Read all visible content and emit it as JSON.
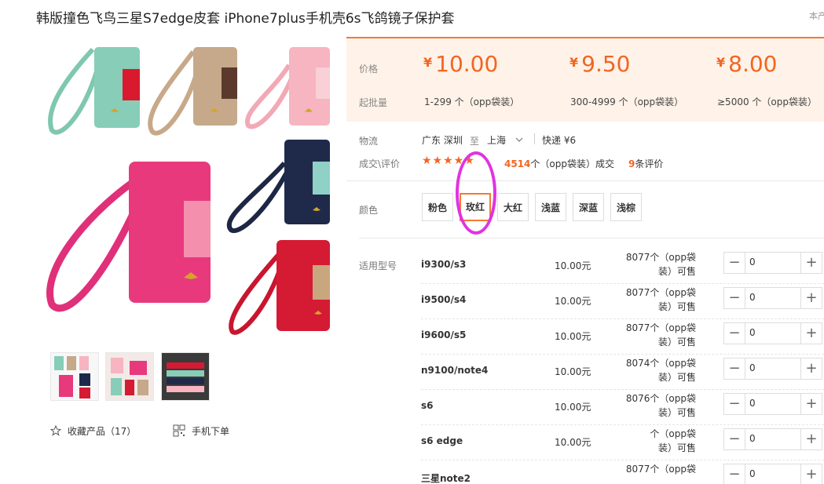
{
  "product": {
    "title": "韩版撞色飞鸟三星S7edge皮套 iPhone7plus手机壳6s飞鸽镜子保护套",
    "corner_text": "本产"
  },
  "gallery": {
    "favorite_label": "收藏产品（17）",
    "mobile_label": "手机下单"
  },
  "price": {
    "price_label": "价格",
    "moq_label": "起批量",
    "tiers": [
      {
        "currency": "¥",
        "price": "10.00",
        "range": "1-299 个（opp袋装）"
      },
      {
        "currency": "¥",
        "price": "9.50",
        "range": "300-4999 个（opp袋装）"
      },
      {
        "currency": "¥",
        "price": "8.00",
        "range": "≥5000 个（opp袋装）"
      }
    ]
  },
  "logistics": {
    "label": "物流",
    "from": "广东 深圳",
    "to_word": "至",
    "to": "上海",
    "express": "快递 ¥6"
  },
  "deals": {
    "label": "成交\\评价",
    "rating": 5,
    "stars": "★★★★★",
    "count": "4514",
    "count_suffix": "个（opp袋装）成交",
    "reviews": "9",
    "reviews_suffix": "条评价"
  },
  "color": {
    "label": "颜色",
    "options": [
      "粉色",
      "玫红",
      "大红",
      "浅蓝",
      "深蓝",
      "浅棕"
    ],
    "selected": "玫红"
  },
  "models": {
    "label": "适用型号",
    "rows": [
      {
        "model": "i9300/s3",
        "price": "10.00元",
        "stock_1": "8077个（opp袋",
        "stock_2": "装）可售",
        "qty": "0"
      },
      {
        "model": "i9500/s4",
        "price": "10.00元",
        "stock_1": "8077个（opp袋",
        "stock_2": "装）可售",
        "qty": "0"
      },
      {
        "model": "i9600/s5",
        "price": "10.00元",
        "stock_1": "8077个（opp袋",
        "stock_2": "装）可售",
        "qty": "0"
      },
      {
        "model": "n9100/note4",
        "price": "10.00元",
        "stock_1": "8074个（opp袋",
        "stock_2": "装）可售",
        "qty": "0"
      },
      {
        "model": "s6",
        "price": "10.00元",
        "stock_1": "8076个（opp袋",
        "stock_2": "装）可售",
        "qty": "0"
      },
      {
        "model": "s6 edge",
        "price": "10.00元",
        "stock_1": "个（opp袋",
        "stock_2": "装）可售",
        "qty": "0"
      },
      {
        "model": "三星note2",
        "price": "",
        "stock_1": "8077个（opp袋",
        "stock_2": "",
        "qty": "0"
      }
    ],
    "minus": "−",
    "plus": "+"
  },
  "colors": {
    "accent": "#f26522",
    "price_bg": "#fff2e8",
    "annotation": "#e033e0"
  }
}
